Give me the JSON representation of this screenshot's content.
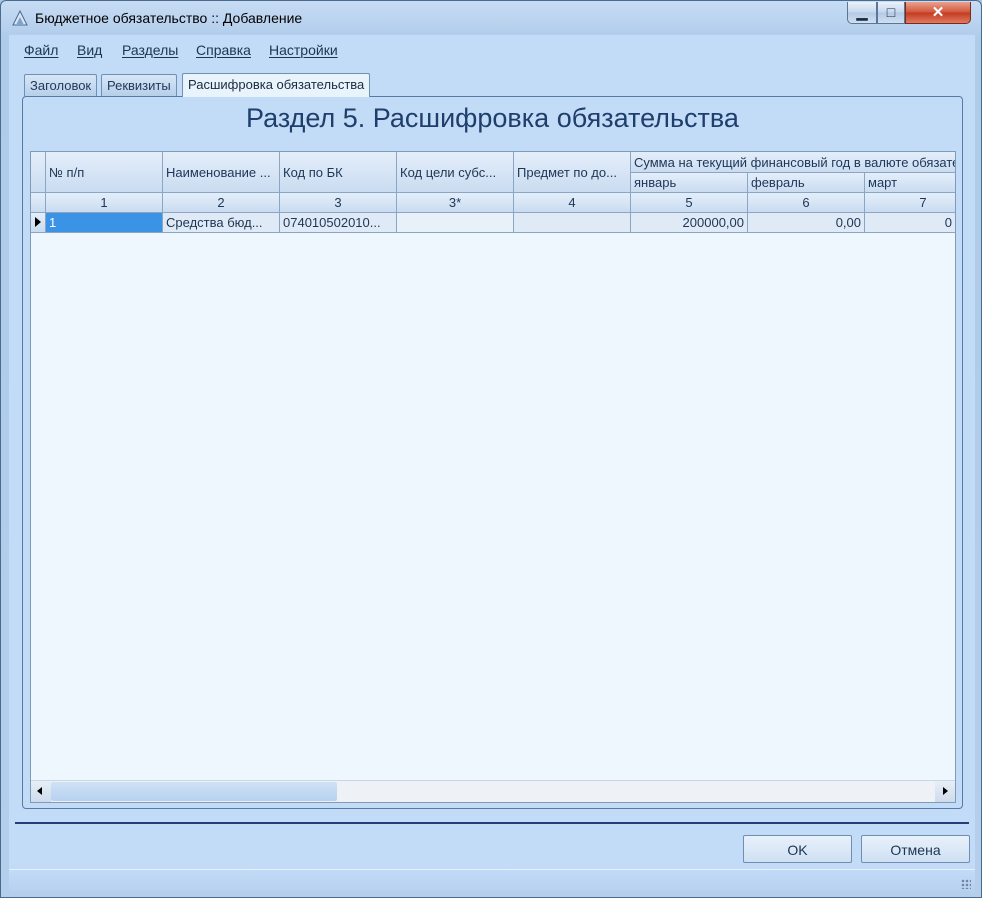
{
  "window": {
    "title": "Бюджетное обязательство :: Добавление",
    "controls": {
      "minimize": "▁",
      "maximize": "□",
      "close": "✕"
    }
  },
  "menubar": {
    "items": [
      "Файл",
      "Вид",
      "Разделы",
      "Справка",
      "Настройки"
    ]
  },
  "tabs": [
    "Заголовок",
    "Реквизиты",
    "Расшифровка обязательства"
  ],
  "active_tab": "Расшифровка обязательства",
  "section": {
    "title": "Раздел 5. Расшифровка обязательства"
  },
  "grid": {
    "headers": [
      "№ п/п",
      "Наименование ...",
      "Код по БК",
      "Код цели субс...",
      "Предмет по до..."
    ],
    "group_header": "Сумма на текущий финансовый год в валюте обязательства",
    "sub_headers": [
      "январь",
      "февраль",
      "март"
    ],
    "numbers": [
      "1",
      "2",
      "3",
      "3*",
      "4",
      "5",
      "6",
      "7"
    ],
    "rows": [
      [
        "1",
        "Средства бюд...",
        "074010502010...",
        "",
        "",
        "200000,00",
        "0,00",
        "0"
      ]
    ]
  },
  "buttons": {
    "ok": "OK",
    "cancel": "Отмена"
  }
}
